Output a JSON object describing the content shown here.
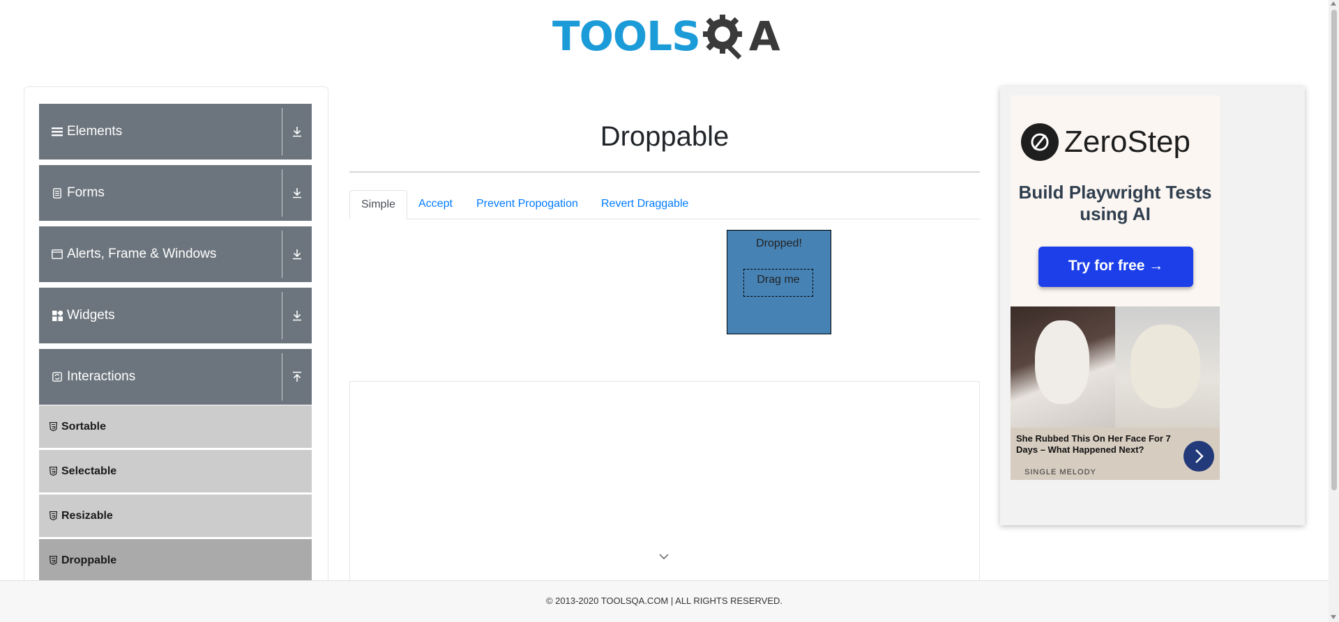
{
  "header": {
    "logo_tools": "TOOLS",
    "logo_qa": "A"
  },
  "sidebar": {
    "groups": [
      {
        "label": "Elements",
        "icon": "hamburger-icon",
        "arrow": "download-icon"
      },
      {
        "label": "Forms",
        "icon": "document-icon",
        "arrow": "download-icon"
      },
      {
        "label": "Alerts, Frame & Windows",
        "icon": "window-icon",
        "arrow": "download-icon"
      },
      {
        "label": "Widgets",
        "icon": "widgets-icon",
        "arrow": "download-icon"
      },
      {
        "label": "Interactions",
        "icon": "interactions-icon",
        "arrow": "upload-icon"
      }
    ],
    "items": [
      {
        "label": "Sortable",
        "active": false
      },
      {
        "label": "Selectable",
        "active": false
      },
      {
        "label": "Resizable",
        "active": false
      },
      {
        "label": "Droppable",
        "active": true
      }
    ]
  },
  "main": {
    "title": "Droppable",
    "tabs": [
      {
        "label": "Simple",
        "active": true
      },
      {
        "label": "Accept",
        "active": false
      },
      {
        "label": "Prevent Propogation",
        "active": false
      },
      {
        "label": "Revert Draggable",
        "active": false
      }
    ],
    "drop_text": "Dropped!",
    "drag_text": "Drag me"
  },
  "ad": {
    "brand": "ZeroStep",
    "tagline": "Build Playwright Tests using AI",
    "button": "Try for free →",
    "caption": "She Rubbed This On Her Face For 7 Days – What Happened Next?",
    "source": "SINGLE MELODY"
  },
  "footer": {
    "text": "© 2013-2020 TOOLSQA.COM | ALL RIGHTS RESERVED."
  },
  "colors": {
    "group_bg": "#6c757d",
    "item_bg": "#cccccc",
    "item_active_bg": "#aaaaaa",
    "drop_bg": "#4682b4",
    "link": "#007bff",
    "ad_button": "#1c3fea"
  }
}
